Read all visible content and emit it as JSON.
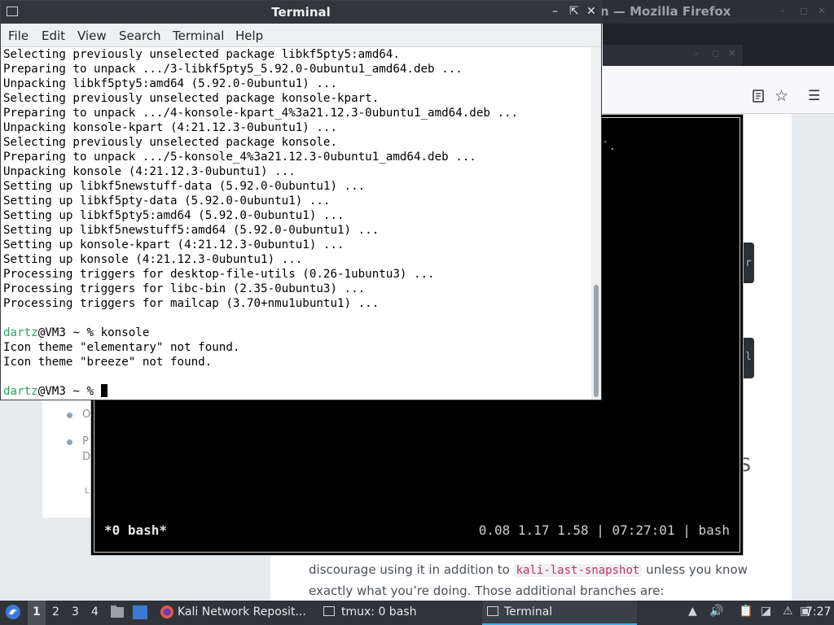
{
  "firefox": {
    "title_fragment": "n — Mozilla Firefox",
    "article_line1_pre": "discourage using it in addition to",
    "article_code": "kali-last-snapshot",
    "article_line1_post": "unless you know",
    "article_line2": "exactly what you’re doing. Those additional branches are:",
    "left_stub_1": "O",
    "left_stub_2": "P",
    "left_stub_3": "D",
    "left_stub_4": "L",
    "code_stub_1": "r",
    "code_stub_2": "l",
    "side_glyph": "S"
  },
  "tmux": {
    "status_left": "*0 bash*",
    "status_right": "0.08 1.17 1.58 | 07:27:01 | bash",
    "dots": "`."
  },
  "terminal": {
    "title": "Terminal",
    "menu": [
      "File",
      "Edit",
      "View",
      "Search",
      "Terminal",
      "Help"
    ],
    "output": [
      "Selecting previously unselected package libkf5pty5:amd64.",
      "Preparing to unpack .../3-libkf5pty5_5.92.0-0ubuntu1_amd64.deb ...",
      "Unpacking libkf5pty5:amd64 (5.92.0-0ubuntu1) ...",
      "Selecting previously unselected package konsole-kpart.",
      "Preparing to unpack .../4-konsole-kpart_4%3a21.12.3-0ubuntu1_amd64.deb ...",
      "Unpacking konsole-kpart (4:21.12.3-0ubuntu1) ...",
      "Selecting previously unselected package konsole.",
      "Preparing to unpack .../5-konsole_4%3a21.12.3-0ubuntu1_amd64.deb ...",
      "Unpacking konsole (4:21.12.3-0ubuntu1) ...",
      "Setting up libkf5newstuff-data (5.92.0-0ubuntu1) ...",
      "Setting up libkf5pty-data (5.92.0-0ubuntu1) ...",
      "Setting up libkf5pty5:amd64 (5.92.0-0ubuntu1) ...",
      "Setting up libkf5newstuff5:amd64 (5.92.0-0ubuntu1) ...",
      "Setting up konsole-kpart (4:21.12.3-0ubuntu1) ...",
      "Setting up konsole (4:21.12.3-0ubuntu1) ...",
      "Processing triggers for desktop-file-utils (0.26-1ubuntu3) ...",
      "Processing triggers for libc-bin (2.35-0ubuntu3) ...",
      "Processing triggers for mailcap (3.70+nmu1ubuntu1) ..."
    ],
    "prompt_user": "dartz",
    "prompt_rest": "@VM3 ~ % ",
    "command": "konsole",
    "after_command": [
      "Icon theme \"elementary\" not found.",
      "Icon theme \"breeze\" not found."
    ]
  },
  "taskbar": {
    "workspaces": [
      "1",
      "2",
      "3",
      "4"
    ],
    "tasks": [
      {
        "label": "Kali Network Reposit...",
        "icon": "firefox-icon"
      },
      {
        "label": "tmux: 0 bash",
        "icon": "terminal-icon"
      },
      {
        "label": "Terminal",
        "icon": "terminal-icon"
      }
    ],
    "clock": "7:27"
  },
  "colors": {
    "prompt_user": "#2f9f6a",
    "taskbar_bg": "#2f343a",
    "titlebar_bg": "#31363b",
    "active_task_underline": "#3daee9"
  }
}
